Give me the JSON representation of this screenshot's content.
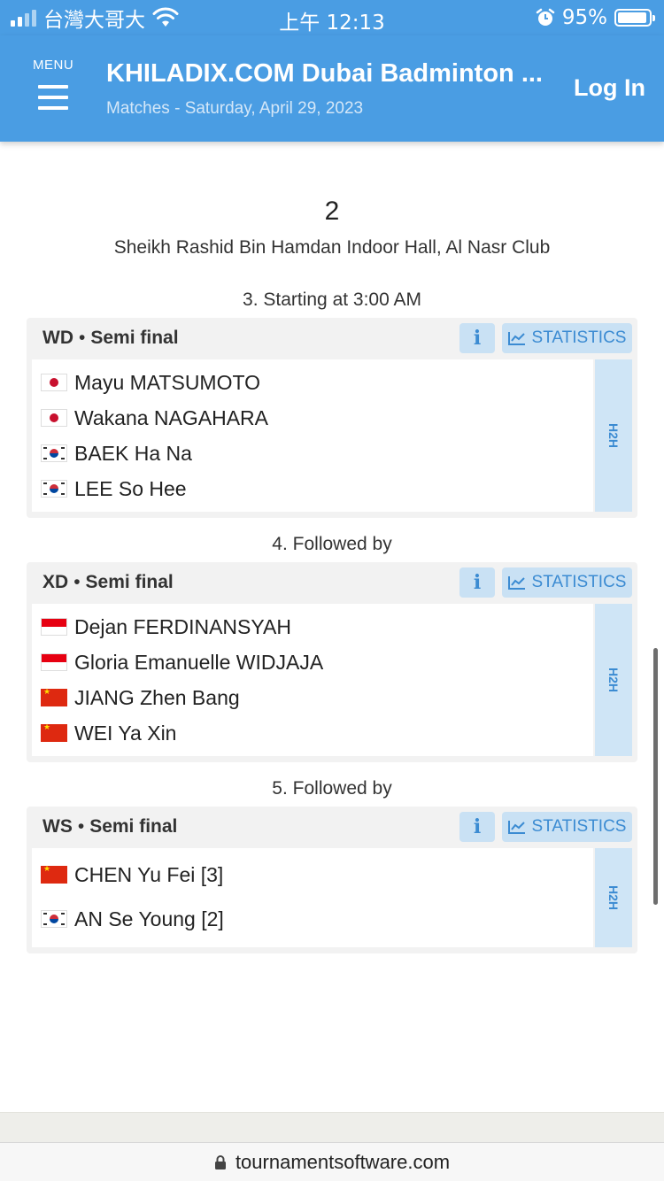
{
  "status_bar": {
    "carrier": "台灣大哥大",
    "time": "上午 12:13",
    "battery_percent": "95%"
  },
  "header": {
    "menu_label": "MENU",
    "title": "KHILADIX.COM Dubai Badminton ...",
    "subtitle": "Matches - Saturday, April 29, 2023",
    "login": "Log In"
  },
  "court": {
    "number": "2",
    "venue": "Sheikh Rashid Bin Hamdan Indoor Hall, Al Nasr Club"
  },
  "buttons": {
    "info": "i",
    "statistics": "STATISTICS",
    "h2h": "H2H"
  },
  "matches": [
    {
      "caption": "3. Starting at 3:00 AM",
      "event": "WD",
      "round": "Semi final",
      "players": [
        {
          "name": "Mayu MATSUMOTO",
          "flag": "jp"
        },
        {
          "name": "Wakana NAGAHARA",
          "flag": "jp"
        },
        {
          "name": "BAEK Ha Na",
          "flag": "kr"
        },
        {
          "name": "LEE So Hee",
          "flag": "kr"
        }
      ]
    },
    {
      "caption": "4. Followed by",
      "event": "XD",
      "round": "Semi final",
      "players": [
        {
          "name": "Dejan FERDINANSYAH",
          "flag": "id"
        },
        {
          "name": "Gloria Emanuelle WIDJAJA",
          "flag": "id"
        },
        {
          "name": "JIANG Zhen Bang",
          "flag": "cn"
        },
        {
          "name": "WEI Ya Xin",
          "flag": "cn"
        }
      ]
    },
    {
      "caption": "5. Followed by",
      "event": "WS",
      "round": "Semi final",
      "players": [
        {
          "name": "CHEN Yu Fei [3]",
          "flag": "cn"
        },
        {
          "name": "AN Se Young [2]",
          "flag": "kr"
        }
      ]
    }
  ],
  "browser": {
    "url": "tournamentsoftware.com"
  },
  "colors": {
    "header_bg": "#4a9de3",
    "button_bg": "#c9e1f4",
    "button_text": "#3b8bd2"
  }
}
